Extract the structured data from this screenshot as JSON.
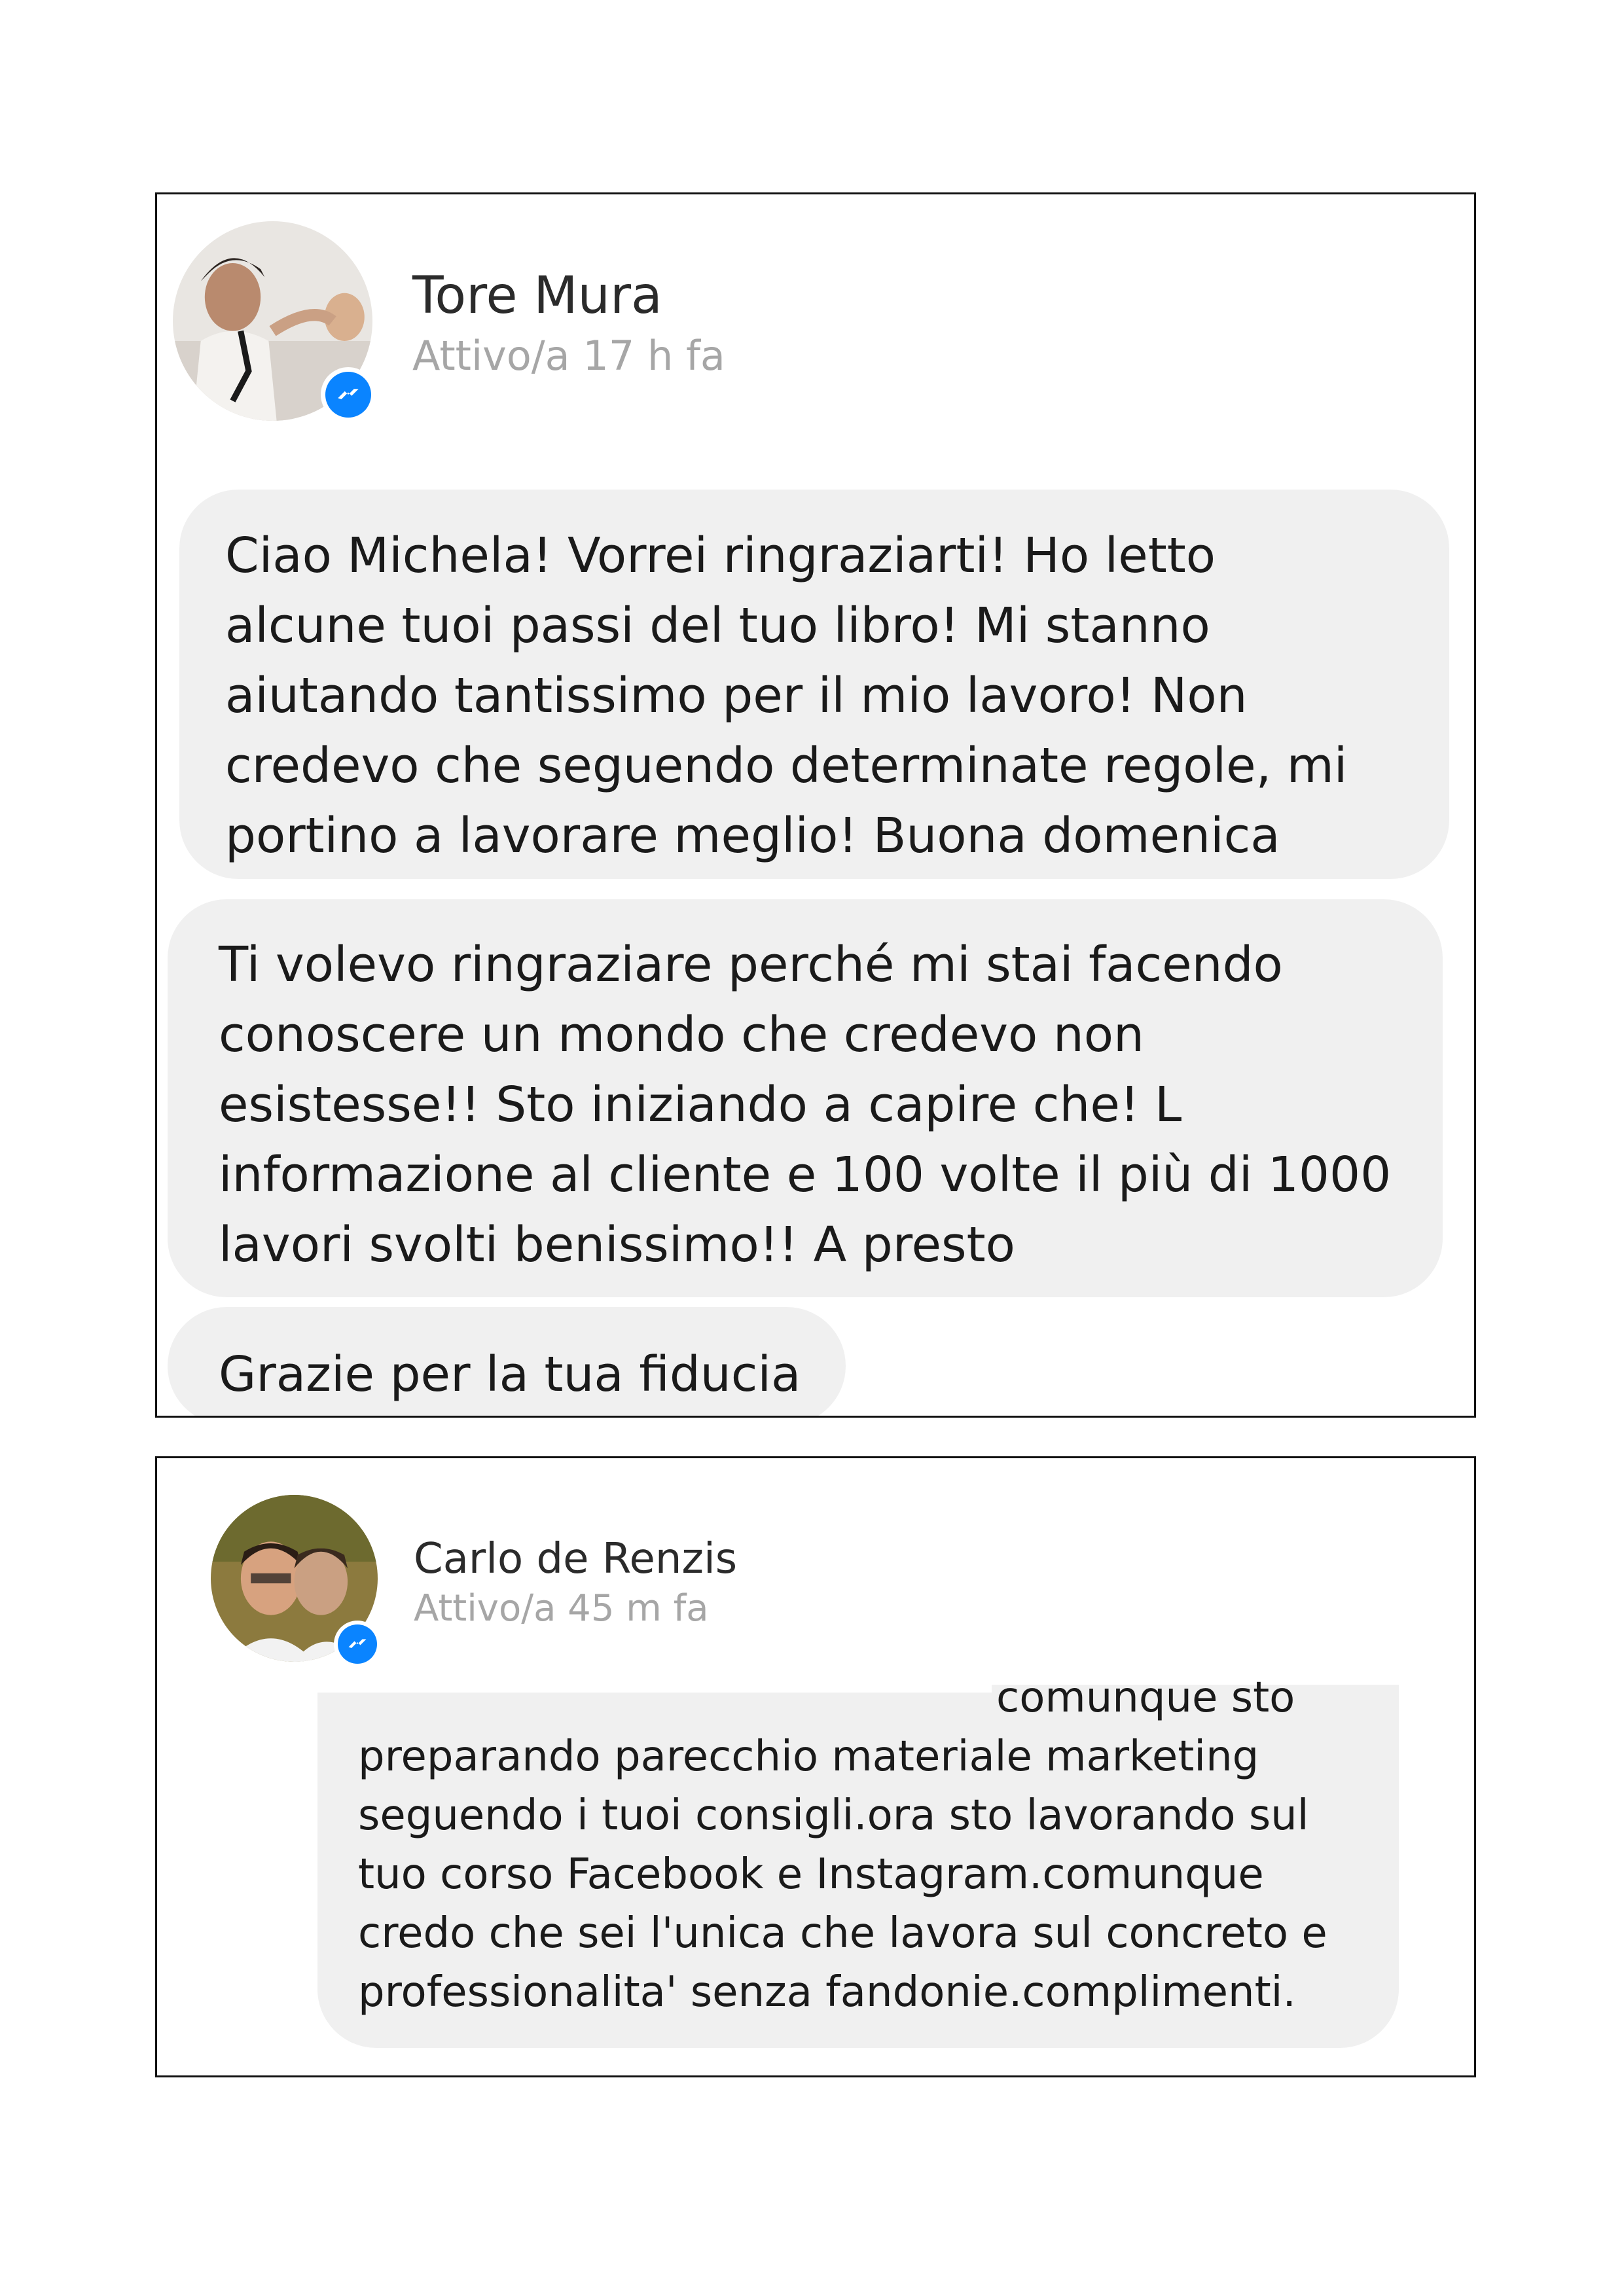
{
  "conversations": [
    {
      "name": "Tore Mura",
      "status": "Attivo/a 17 h fa",
      "avatar_icon": "profile-photo",
      "badge_icon": "messenger-icon",
      "messages": [
        {
          "lines": [
            "Ciao Michela!  Vorrei ringraziarti! Ho letto",
            "alcune tuoi passi del tuo libro! Mi stanno",
            "aiutando tantissimo per il mio lavoro! Non",
            "credevo che seguendo determinate regole, mi",
            "portino a lavorare meglio! Buona domenica"
          ]
        },
        {
          "lines": [
            "Ti volevo ringraziare perché mi stai facendo",
            "conoscere un mondo che credevo non",
            "esistesse!! Sto iniziando a capire che! L",
            "informazione al cliente e 100 volte il più di 1000",
            "lavori svolti benissimo!! A presto"
          ]
        },
        {
          "lines": [
            "Grazie per la tua fiducia"
          ]
        }
      ]
    },
    {
      "name": "Carlo de Renzis",
      "status": "Attivo/a 45 m fa",
      "avatar_icon": "profile-photo",
      "badge_icon": "messenger-icon",
      "messages": [
        {
          "lines": [
            "comunque sto",
            "preparando parecchio materiale marketing",
            "seguendo i tuoi consigli.ora sto lavorando sul",
            "tuo corso Facebook e Instagram.comunque",
            "credo che sei l'unica che lavora sul concreto e",
            "professionalita' senza fandonie.complimenti."
          ]
        }
      ]
    }
  ],
  "colors": {
    "bubble": "#f0f0f0",
    "messenger_blue": "#0a84ff",
    "status_text": "#a6a6a6",
    "border": "#111111"
  }
}
